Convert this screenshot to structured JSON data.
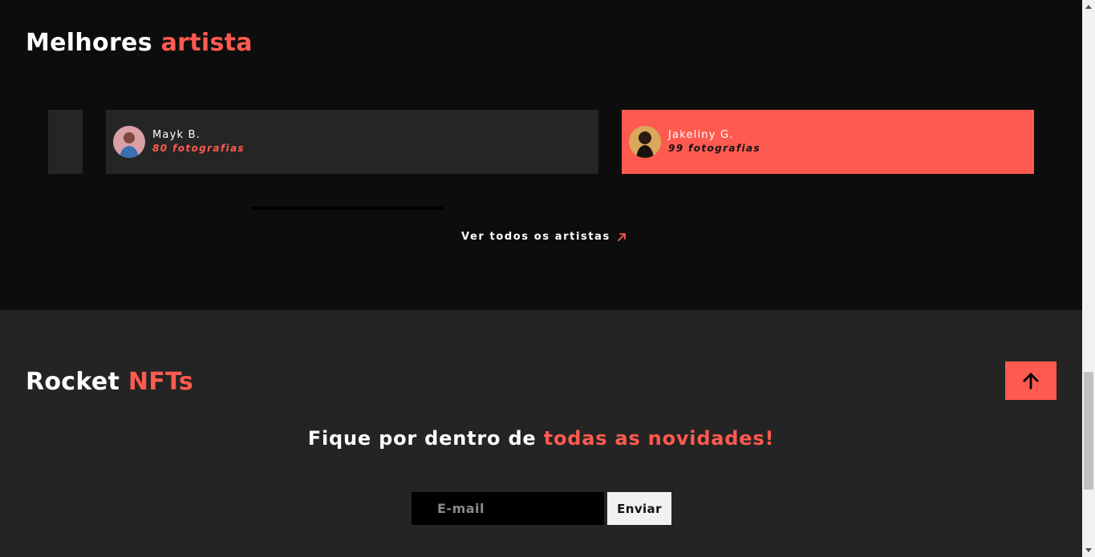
{
  "artists_section": {
    "title_main": "Melhores",
    "title_accent": "artista",
    "cards": [
      {
        "name": "Mayk B.",
        "count": "80 fotografias"
      },
      {
        "name": "Jakeliny G.",
        "count": "99 fotografias"
      }
    ],
    "see_all_label": "Ver todos os artistas"
  },
  "footer": {
    "brand_main": "Rocket",
    "brand_accent": "NFTs",
    "newsletter_title_main": "Fique por dentro de",
    "newsletter_title_accent": "todas as novidades!",
    "email_placeholder": "E-mail",
    "send_label": "Enviar"
  },
  "colors": {
    "accent": "#ff5a4f",
    "dark_background": "#0d0d0d",
    "card_background": "#252525",
    "footer_background": "#242424"
  },
  "icons": {
    "see_all": "arrow-up-right-icon",
    "back_to_top": "arrow-up-icon"
  }
}
